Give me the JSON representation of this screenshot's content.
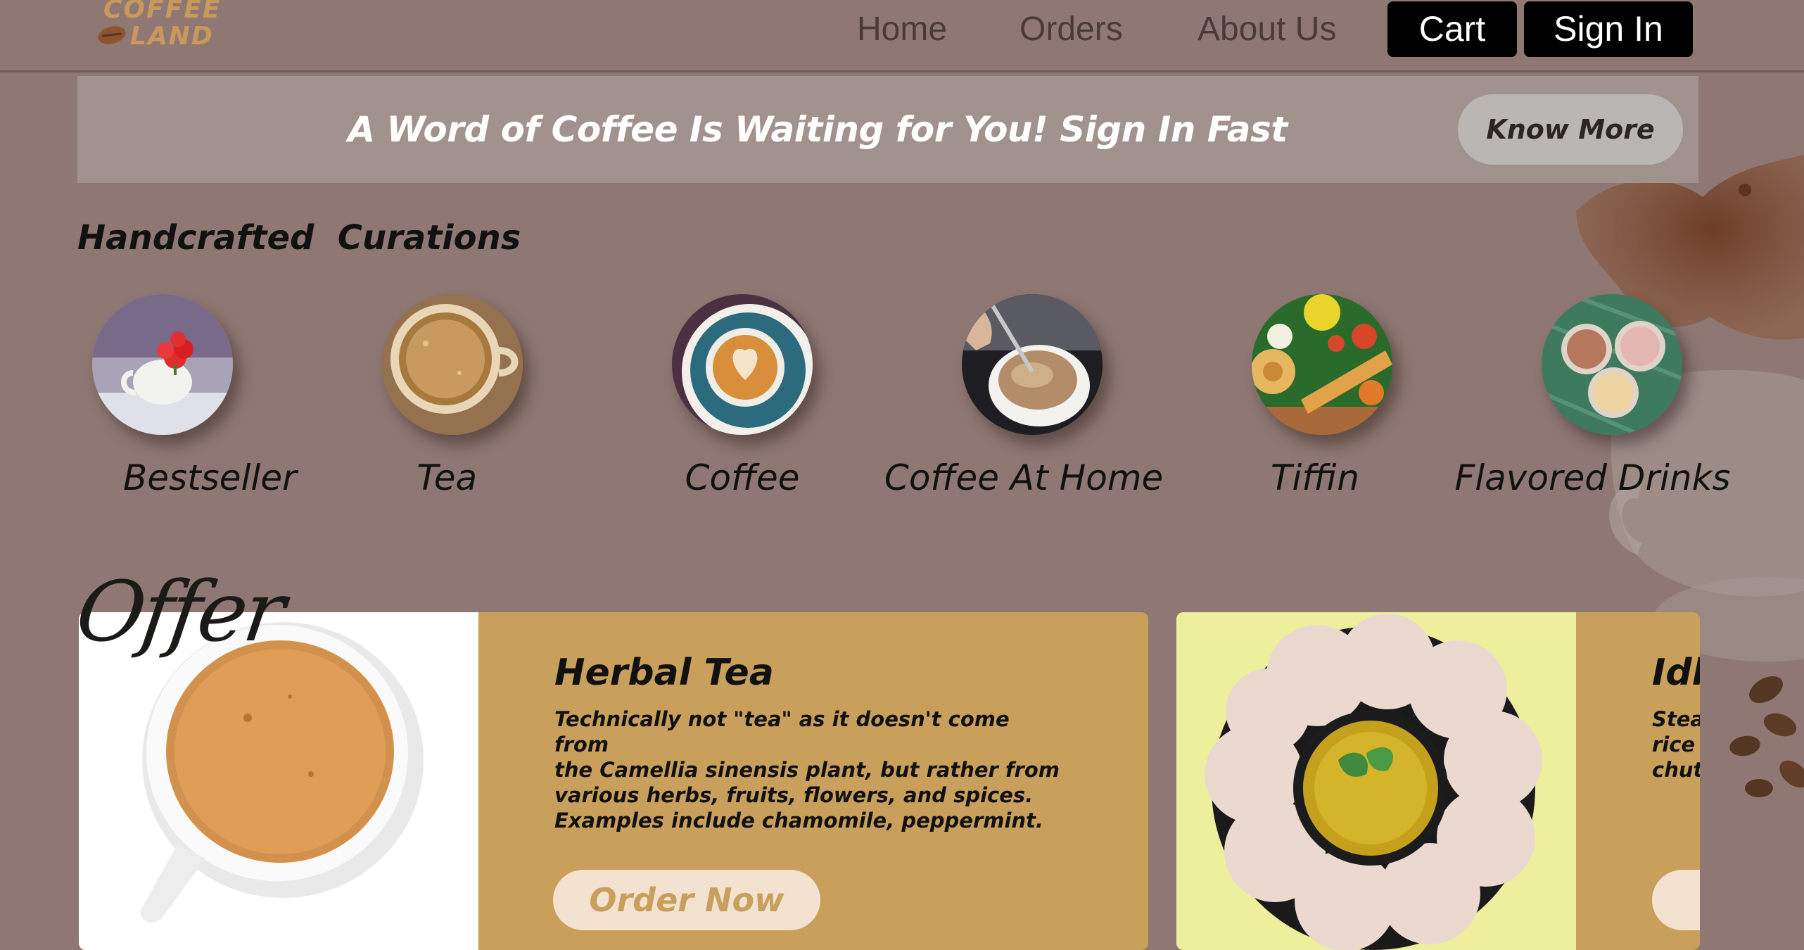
{
  "header": {
    "logo_line1": "COFFEE",
    "logo_line2": "LAND",
    "nav": [
      "Home",
      "Orders",
      "About Us"
    ],
    "cart_label": "Cart",
    "signin_label": "Sign In"
  },
  "banner": {
    "text": "A Word of Coffee Is Waiting for You! Sign In Fast",
    "button_label": "Know More"
  },
  "curations": {
    "title": "Handcrafted  Curations",
    "items": [
      {
        "label": "Bestseller",
        "icon": "bestseller-cup-icon"
      },
      {
        "label": "Tea",
        "icon": "tea-cup-icon"
      },
      {
        "label": "Coffee",
        "icon": "coffee-latte-icon"
      },
      {
        "label": "Coffee At Home",
        "icon": "home-coffee-icon"
      },
      {
        "label": "Tiffin",
        "icon": "tiffin-plate-icon"
      },
      {
        "label": "Flavored Drinks",
        "icon": "flavored-drinks-icon"
      }
    ]
  },
  "offer": {
    "title": "Offer",
    "cards": [
      {
        "title": "Herbal Tea",
        "description_lines": [
          "Technically not \"tea\" as it doesn't come from",
          "the Camellia sinensis plant, but rather from",
          "various herbs, fruits, flowers, and spices.",
          "Examples include chamomile, peppermint."
        ],
        "button_label": "Order Now"
      },
      {
        "title": "Idli",
        "description_lines": [
          "Stea",
          "rice a",
          "chut"
        ],
        "button_label": "O"
      }
    ]
  },
  "colors": {
    "background": "#8f7873",
    "banner": "#a1928e",
    "card": "#c99f5c",
    "order_button": "#f3e2cf",
    "logo": "#c9985a"
  }
}
